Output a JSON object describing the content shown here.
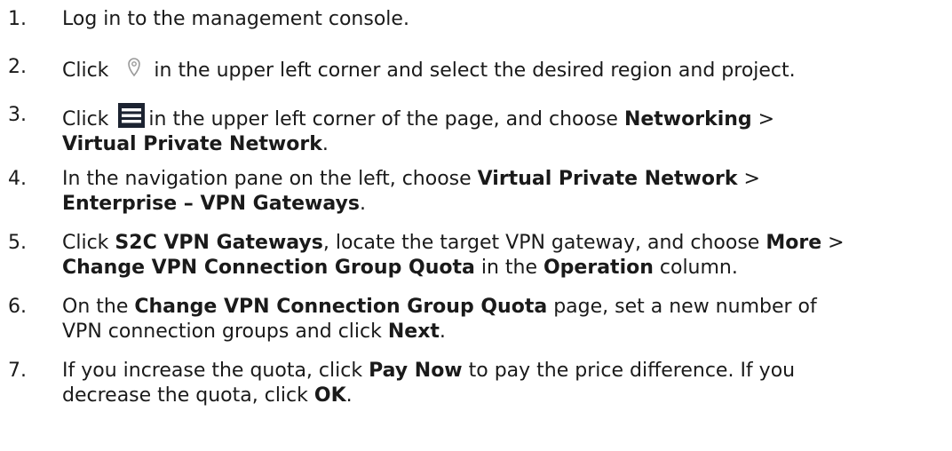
{
  "steps": [
    {
      "number": "1.",
      "parts": [
        {
          "t": "Log in to the management console."
        }
      ]
    },
    {
      "number": "2.",
      "parts": [
        {
          "t": "Click"
        },
        {
          "icon": "location-pin-icon"
        },
        {
          "t": "in the upper left corner and select the desired region and project."
        }
      ]
    },
    {
      "number": "3.",
      "parts": [
        {
          "t": "Click"
        },
        {
          "icon": "menu-icon"
        },
        {
          "t": "in the upper left corner of the page, and choose "
        },
        {
          "t": "Networking",
          "b": true
        },
        {
          "t": " >"
        },
        {
          "br": true
        },
        {
          "t": "Virtual Private Network",
          "b": true
        },
        {
          "t": "."
        }
      ]
    },
    {
      "number": "4.",
      "parts": [
        {
          "t": "In the navigation pane on the left, choose "
        },
        {
          "t": "Virtual Private Network",
          "b": true
        },
        {
          "t": " >"
        },
        {
          "br": true
        },
        {
          "t": "Enterprise – VPN Gateways",
          "b": true
        },
        {
          "t": "."
        }
      ]
    },
    {
      "number": "5.",
      "parts": [
        {
          "t": "Click "
        },
        {
          "t": "S2C VPN Gateways",
          "b": true
        },
        {
          "t": ", locate the target VPN gateway, and choose "
        },
        {
          "t": "More",
          "b": true
        },
        {
          "t": " >"
        },
        {
          "br": true
        },
        {
          "t": "Change VPN Connection Group Quota",
          "b": true
        },
        {
          "t": " in the "
        },
        {
          "t": "Operation",
          "b": true
        },
        {
          "t": " column."
        }
      ]
    },
    {
      "number": "6.",
      "parts": [
        {
          "t": "On the "
        },
        {
          "t": "Change VPN Connection Group Quota",
          "b": true
        },
        {
          "t": " page, set a new number of"
        },
        {
          "br": true
        },
        {
          "t": "VPN connection groups and click "
        },
        {
          "t": "Next",
          "b": true
        },
        {
          "t": "."
        }
      ]
    },
    {
      "number": "7.",
      "parts": [
        {
          "t": "If you increase the quota, click "
        },
        {
          "t": "Pay Now",
          "b": true
        },
        {
          "t": " to pay the price difference. If you"
        },
        {
          "br": true
        },
        {
          "t": "decrease the quota, click "
        },
        {
          "t": "OK",
          "b": true
        },
        {
          "t": "."
        }
      ]
    }
  ]
}
